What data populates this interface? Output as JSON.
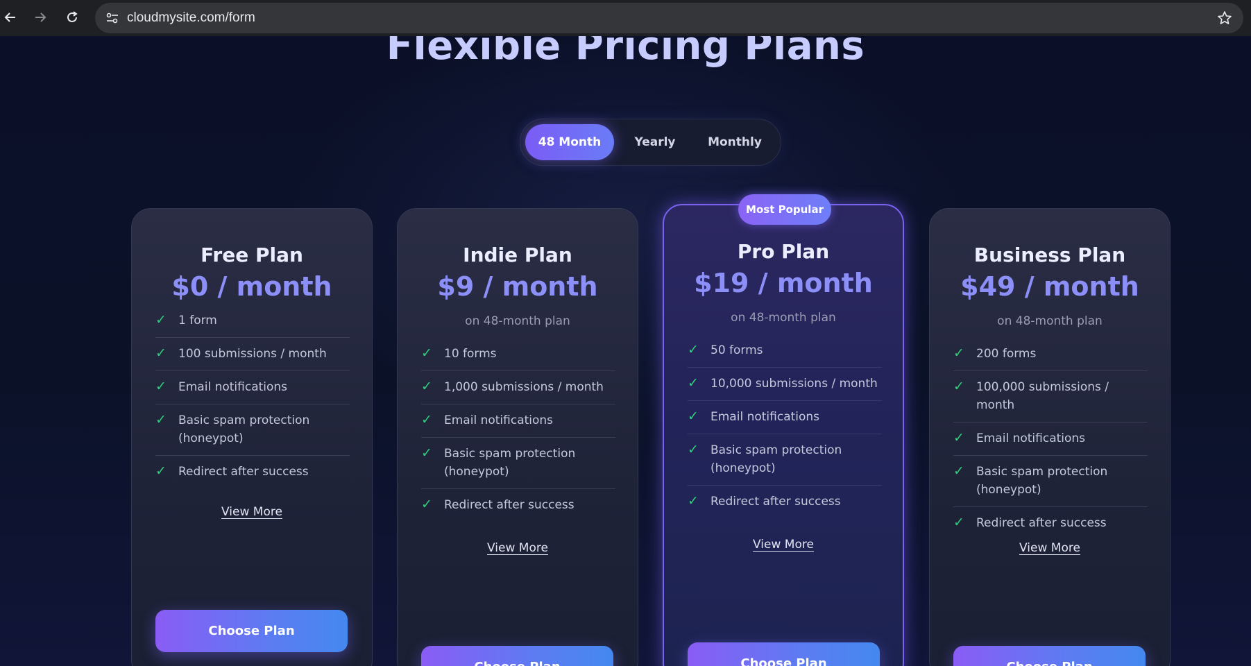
{
  "browser": {
    "url": "cloudmysite.com/form"
  },
  "page": {
    "title": "Flexible Pricing Plans"
  },
  "billing_toggle": {
    "options": [
      "48 Month",
      "Yearly",
      "Monthly"
    ],
    "selected": "48 Month"
  },
  "plans": [
    {
      "name": "Free Plan",
      "price": "$0 / month",
      "features": [
        "1 form",
        "100 submissions / month",
        "Email notifications",
        "Basic spam protection (honeypot)",
        "Redirect after success"
      ],
      "view_more": "View More",
      "cta": "Choose Plan"
    },
    {
      "name": "Indie Plan",
      "price": "$9 / month",
      "subtitle": "on 48-month plan",
      "features": [
        "10 forms",
        "1,000 submissions / month",
        "Email notifications",
        "Basic spam protection (honeypot)",
        "Redirect after success"
      ],
      "view_more": "View More",
      "cta": "Choose Plan"
    },
    {
      "name": "Pro Plan",
      "badge": "Most Popular",
      "price": "$19 / month",
      "subtitle": "on 48-month plan",
      "features": [
        "50 forms",
        "10,000 submissions / month",
        "Email notifications",
        "Basic spam protection (honeypot)",
        "Redirect after success"
      ],
      "view_more": "View More",
      "cta": "Choose Plan"
    },
    {
      "name": "Business Plan",
      "price": "$49 / month",
      "subtitle": "on 48-month plan",
      "features": [
        "200 forms",
        "100,000 submissions / month",
        "Email notifications",
        "Basic spam protection (honeypot)",
        "Redirect after success"
      ],
      "view_more": "View More",
      "cta": "Choose Plan"
    }
  ],
  "check_glyph": "✓",
  "colors": {
    "accent": "#7b5cf5",
    "price": "#8d8ff8",
    "check": "#2fcf7a",
    "background": "#0a1024"
  }
}
